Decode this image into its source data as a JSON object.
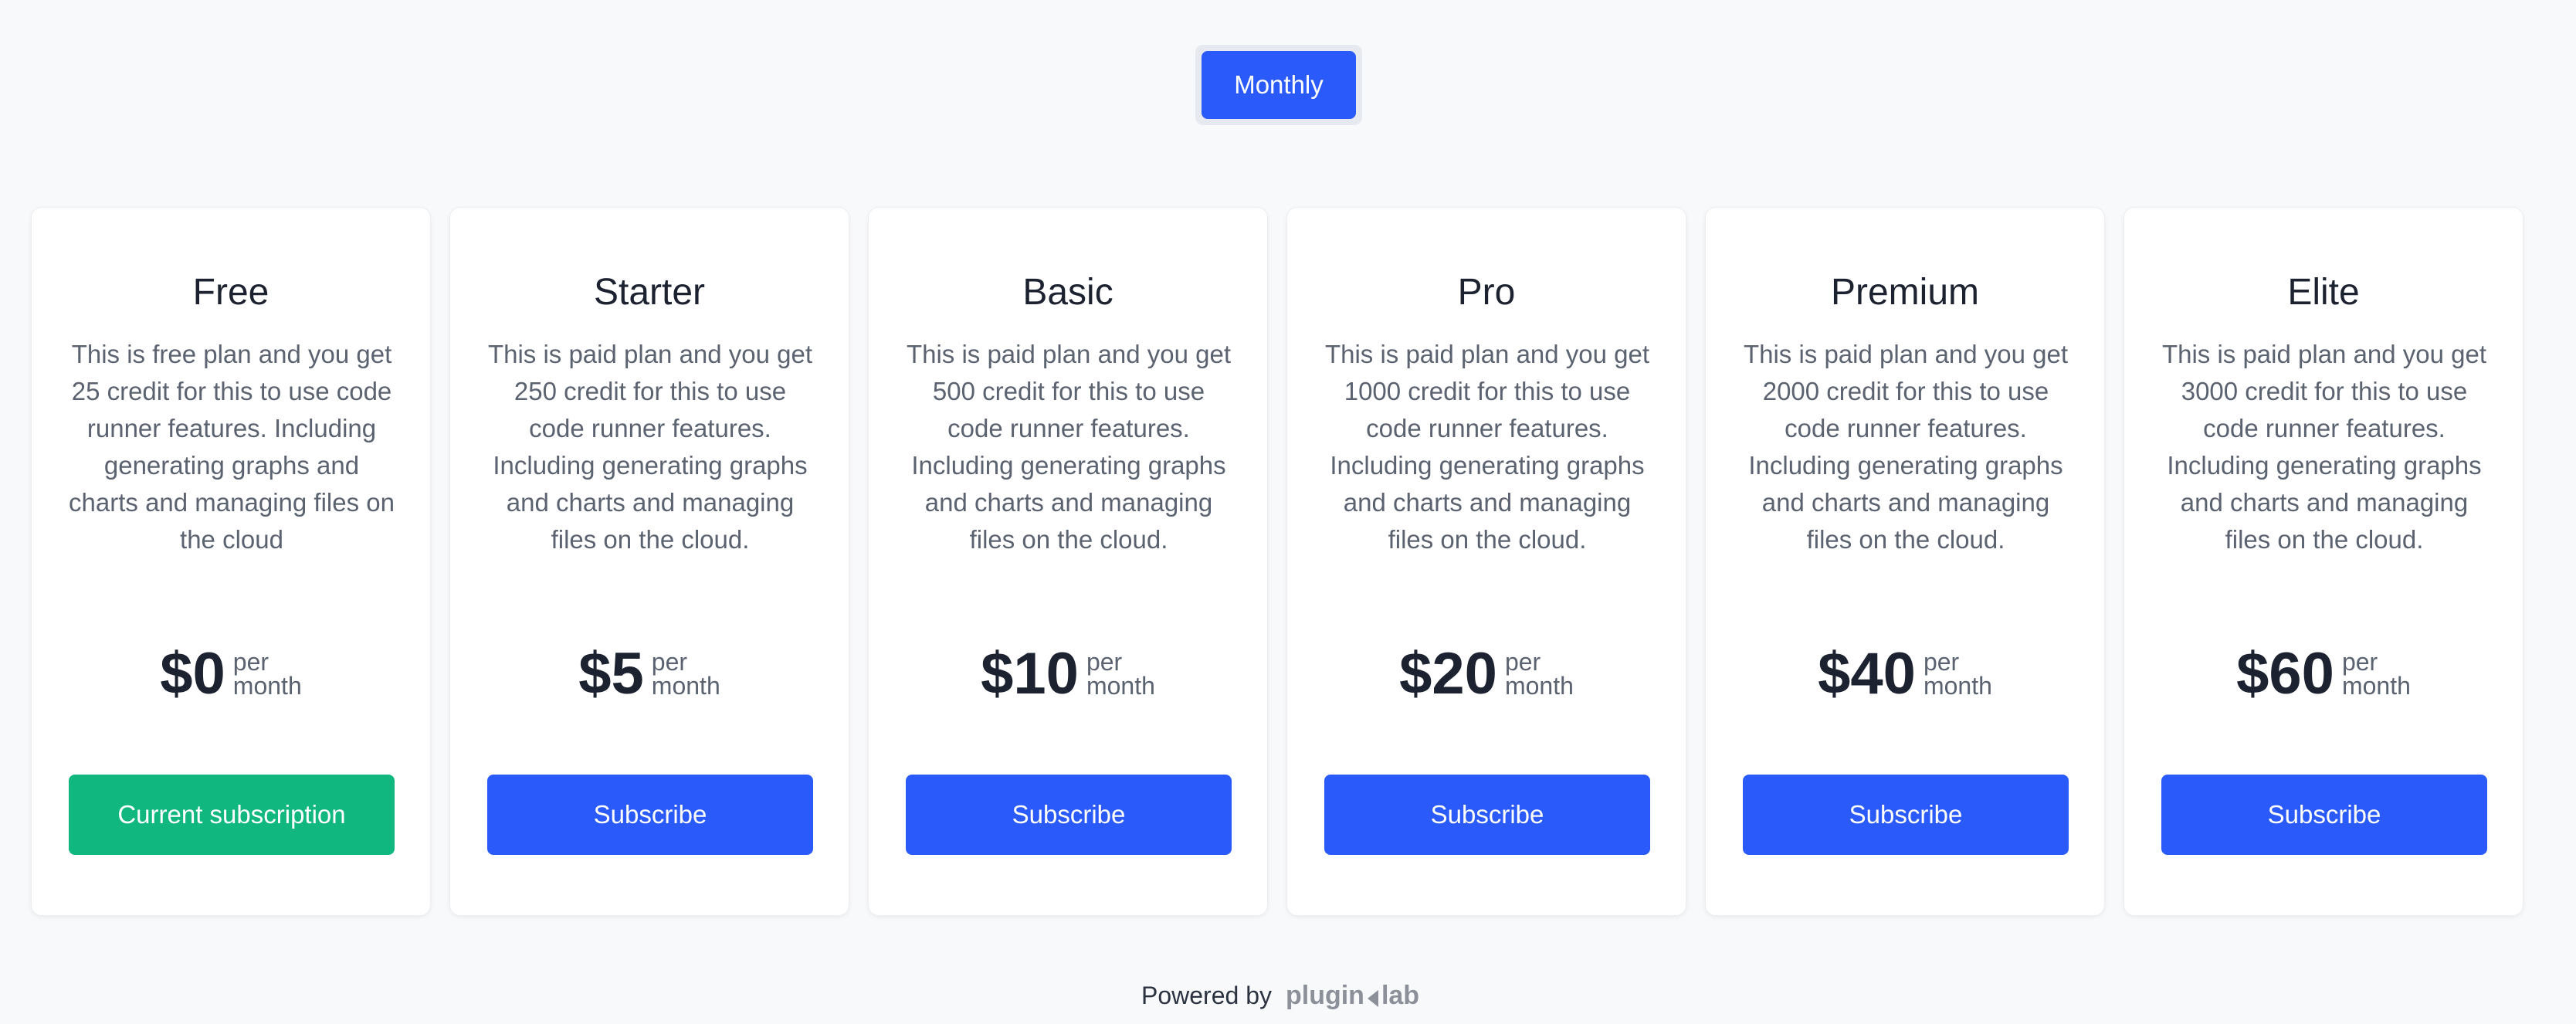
{
  "billing_toggle": {
    "monthly_label": "Monthly"
  },
  "plans": [
    {
      "name": "Free",
      "description": "This is free plan and you get 25 credit for this to use code runner features. Including generating graphs and charts and managing files on the cloud",
      "price": "$0",
      "per": "per",
      "period": "month",
      "button_label": "Current subscription"
    },
    {
      "name": "Starter",
      "description": "This is paid plan and you get 250 credit for this to use code runner features. Including generating graphs and charts and managing files on the cloud.",
      "price": "$5",
      "per": "per",
      "period": "month",
      "button_label": "Subscribe"
    },
    {
      "name": "Basic",
      "description": "This is paid plan and you get 500 credit for this to use code runner features. Including generating graphs and charts and managing files on the cloud.",
      "price": "$10",
      "per": "per",
      "period": "month",
      "button_label": "Subscribe"
    },
    {
      "name": "Pro",
      "description": "This is paid plan and you get 1000 credit for this to use code runner features. Including generating graphs and charts and managing files on the cloud.",
      "price": "$20",
      "per": "per",
      "period": "month",
      "button_label": "Subscribe"
    },
    {
      "name": "Premium",
      "description": "This is paid plan and you get 2000 credit for this to use code runner features. Including generating graphs and charts and managing files on the cloud.",
      "price": "$40",
      "per": "per",
      "period": "month",
      "button_label": "Subscribe"
    },
    {
      "name": "Elite",
      "description": "This is paid plan and you get 3000 credit for this to use code runner features. Including generating graphs and charts and managing files on the cloud.",
      "price": "$60",
      "per": "per",
      "period": "month",
      "button_label": "Subscribe"
    }
  ],
  "footer": {
    "powered_by": "Powered by",
    "brand_part1": "plugin",
    "brand_part2": "lab",
    "brand_icon": "pluginlab-logo-icon"
  },
  "colors": {
    "primary": "#2a5afa",
    "success": "#10b77f",
    "background": "#f8f9fb"
  }
}
